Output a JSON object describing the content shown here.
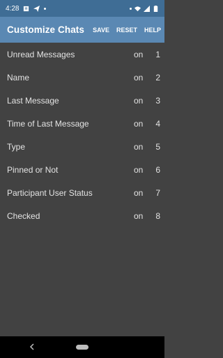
{
  "status_bar": {
    "time": "4:28",
    "icons_left": [
      "sim-card-icon",
      "send-icon",
      "dot-icon"
    ],
    "icons_right": [
      "dot-icon",
      "wifi-icon",
      "signal-icon",
      "battery-icon"
    ]
  },
  "app_bar": {
    "title": "Customize Chats",
    "actions": {
      "save": "SAVE",
      "reset": "RESET",
      "help": "HELP"
    }
  },
  "rows": [
    {
      "label": "Unread Messages",
      "state": "on",
      "order": "1"
    },
    {
      "label": "Name",
      "state": "on",
      "order": "2"
    },
    {
      "label": "Last Message",
      "state": "on",
      "order": "3"
    },
    {
      "label": "Time of Last Message",
      "state": "on",
      "order": "4"
    },
    {
      "label": "Type",
      "state": "on",
      "order": "5"
    },
    {
      "label": "Pinned or Not",
      "state": "on",
      "order": "6"
    },
    {
      "label": "Participant User Status",
      "state": "on",
      "order": "7"
    },
    {
      "label": "Checked",
      "state": "on",
      "order": "8"
    }
  ],
  "colors": {
    "status_bar": "#3f6d95",
    "app_bar": "#5a88b3",
    "background": "#424242",
    "text": "#e3e3e3"
  }
}
